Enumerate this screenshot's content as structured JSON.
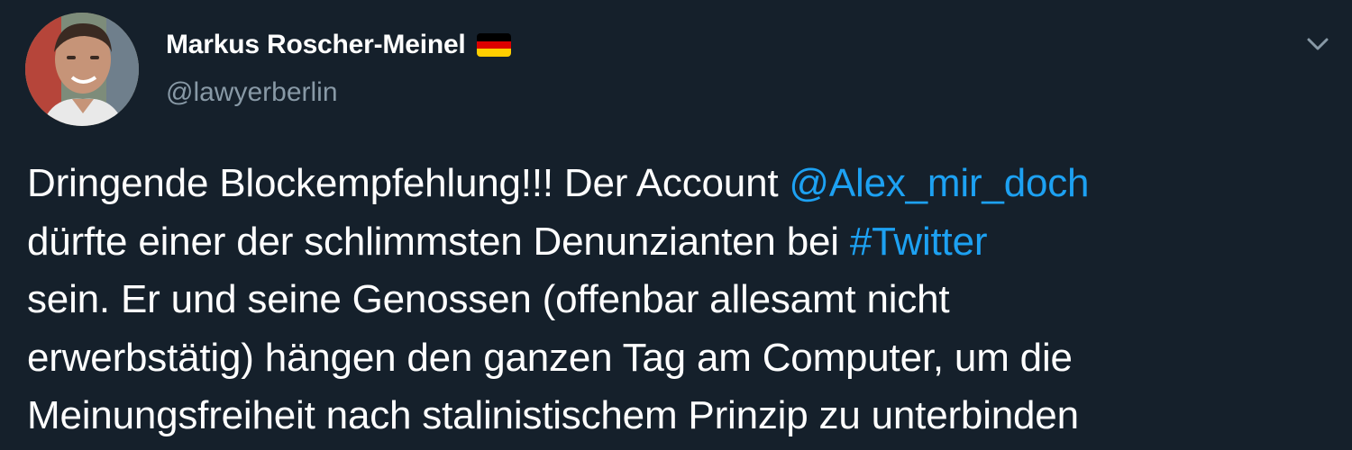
{
  "author": {
    "display_name": "Markus Roscher-Meinel",
    "flag_icon": "german-flag-icon",
    "handle": "@lawyerberlin"
  },
  "menu": {
    "icon": "chevron-down-icon"
  },
  "tweet": {
    "line1_pre": "Dringende Blockempfehlung!!! Der Account ",
    "mention": "@Alex_mir_doch",
    "line2_pre": "dürfte einer der schlimmsten Denunzianten bei ",
    "hashtag": "#Twitter",
    "line3": "sein. Er und seine Genossen (offenbar allesamt nicht",
    "line4": "erwerbstätig) hängen den ganzen Tag am Computer, um die",
    "line5": "Meinungsfreiheit nach stalinistischem Prinzip zu unterbinden"
  },
  "colors": {
    "background": "#15202b",
    "link": "#1da1f2",
    "secondary_text": "#8899a6"
  }
}
